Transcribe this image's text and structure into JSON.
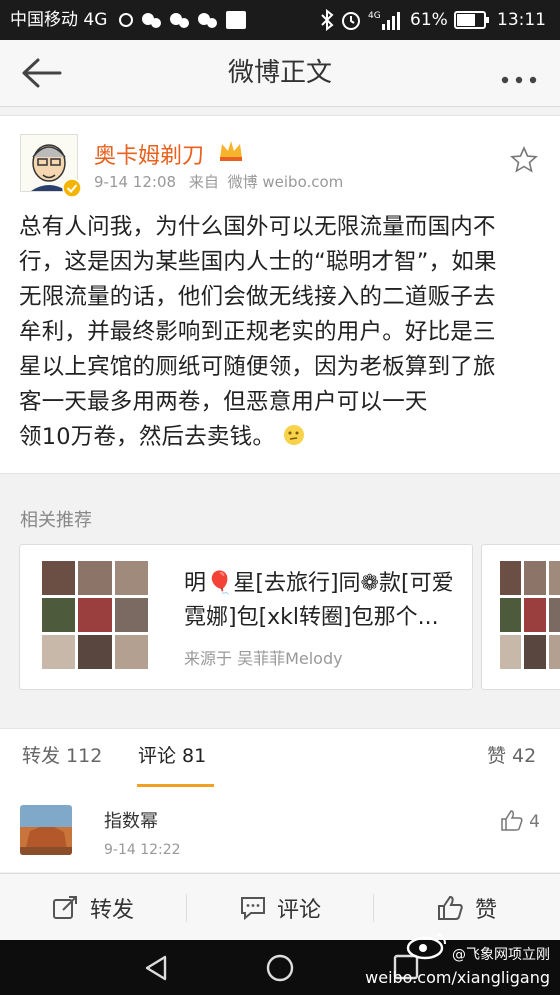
{
  "status_bar": {
    "carrier": "中国移动 4G",
    "battery": "61%",
    "time": "13:11"
  },
  "header": {
    "title": "微博正文",
    "back_icon": "back-arrow-icon",
    "more_icon": "more-dots-icon"
  },
  "post": {
    "username": "奥卡姆剃刀",
    "date": "9-14 12:08",
    "source_prefix": "来自",
    "source": "微博 weibo.com",
    "lines": [
      "总有人问我，为什么国外可以无限流量而国内不",
      "行，这是因为某些国内人士的“聪明才智”，如果",
      "无限流量的话，他们会做无线接入的二道贩子去",
      "牟利，并最终影响到正规老实的用户。好比是三",
      "星以上宾馆的厕纸可随便领，因为老板算到了旅",
      "客一天最多用两卷，但恶意用户可以一天",
      "领10万卷，然后去卖钱。"
    ]
  },
  "related": {
    "label": "相关推荐",
    "card": {
      "title_line1": "明🎈星[去旅行]同❁款[可爱",
      "title_line2": "霓娜]包[xkl转圈]包那个...",
      "source": "来源于 吴菲菲Melody"
    }
  },
  "tabs": {
    "repost": "转发 112",
    "comments": "评论 81",
    "likes": "赞 42"
  },
  "comment": {
    "name": "指数幂",
    "time": "9-14 12:22",
    "likes": "4"
  },
  "toolbar": {
    "repost": "转发",
    "comment": "评论",
    "like": "赞"
  },
  "watermark": {
    "line1": "@飞象网项立刚",
    "line2": "weibo.com/xiangligang"
  },
  "colors": {
    "username": "#e8611f",
    "tab_underline": "#f2a024",
    "status_bar": "#1b1b1b"
  }
}
